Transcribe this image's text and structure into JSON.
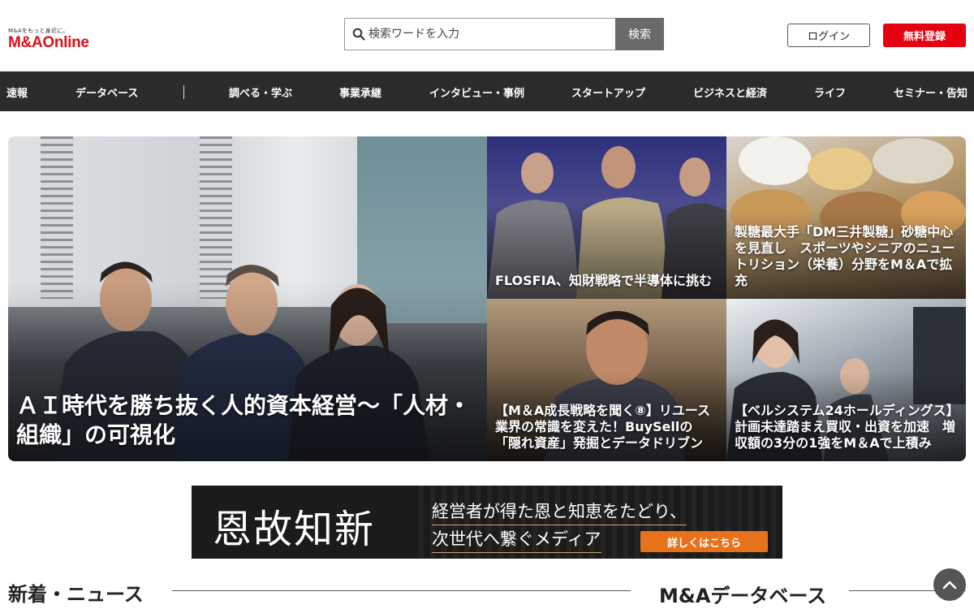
{
  "header": {
    "logo_tagline": "M&Aをもっと身近に。",
    "logo_brand": "M&AOnline",
    "search_placeholder": "検索ワードを入力",
    "search_button": "検索",
    "login_label": "ログイン",
    "register_label": "無料登録",
    "register_color": "#e50012"
  },
  "nav": {
    "items": [
      "速報",
      "データベース",
      "調べる・学ぶ",
      "事業承継",
      "インタビュー・事例",
      "スタートアップ",
      "ビジネスと経済",
      "ライフ",
      "セミナー・告知"
    ]
  },
  "hero": {
    "main": {
      "title": "ＡＩ時代を勝ち抜く人的資本経営～「人材・組織」の可視化"
    },
    "tiles": [
      {
        "title": "FLOSFIA、知財戦略で半導体に挑む"
      },
      {
        "title": "製糖最大手「DM三井製糖」砂糖中心を見直し　スポーツやシニアのニュートリション（栄養）分野をM＆Aで拡充"
      },
      {
        "title": "【M＆A成長戦略を聞く⑧】リユース業界の常識を変えた！BuySellの「隠れ資産」発掘とデータドリブン"
      },
      {
        "title": "【ベルシステム24ホールディングス】計画未達踏まえ買収・出資を加速　増収額の3分の1強をM＆Aで上積み"
      }
    ]
  },
  "banner": {
    "headline": "恩故知新",
    "line1": "経営者が得た恩と知恵をたどり、",
    "line2": "次世代へ繋ぐメディア",
    "cta": "詳しくはこちら",
    "cta_color": "#e8721b"
  },
  "sections": {
    "news_title": "新着・ニュース",
    "database_title": "M&Aデータベース"
  },
  "icons": {
    "search": "search-icon",
    "back_to_top": "chevron-up-icon"
  }
}
